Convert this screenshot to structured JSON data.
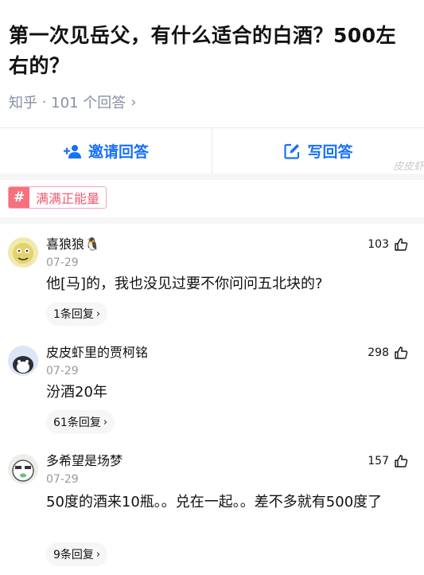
{
  "question": {
    "title": "第一次见岳父，有什么适合的白酒？500左右的？",
    "source": "知乎",
    "answer_count": "101 个回答"
  },
  "actions": {
    "invite_label": "邀请回答",
    "write_label": "写回答"
  },
  "watermark": "皮皮虾",
  "topic": {
    "hash": "#",
    "label": "满满正能量"
  },
  "comments": [
    {
      "name": "喜狼狼🐧",
      "date": "07-29",
      "text": "他[马]的，我也没见过要不你问问五北块的?",
      "replies": "1条回复",
      "likes": "103"
    },
    {
      "name": "皮皮虾里的贾柯铭",
      "date": "07-29",
      "text": "汾酒20年",
      "replies": "61条回复",
      "likes": "298"
    },
    {
      "name": "多希望是场梦",
      "date": "07-29",
      "text": "50度的酒来10瓶。。兑在一起。。差不多就有500度了",
      "replies": "9条回复",
      "likes": "157"
    }
  ],
  "colors": {
    "accent": "#1772f6",
    "topic": "#f7707e",
    "muted": "#8590a6"
  }
}
